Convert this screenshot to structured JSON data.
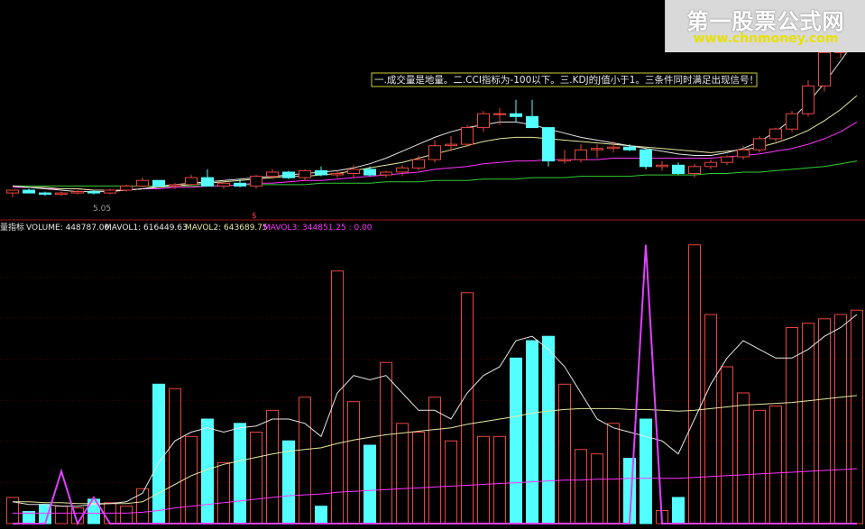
{
  "watermark": {
    "title": "第一股票公式网",
    "url": "www.chnmoney.com"
  },
  "note": "一.成交量是地量。二.CCI指标为-100以下。三.KDJ的J值小于1。三条件同时满足出现信号！",
  "price_label": "5.05",
  "signal_marker": "$",
  "indicator_header": {
    "name": "量指标",
    "volume": "VOLUME: 448787.00",
    "mavol1": "MAVOL1: 616449.63",
    "mavol2": "MAVOL2: 643689.75",
    "mavol3": "MAVOL3: 344851.25 : 0.00"
  },
  "colors": {
    "up": "#e8463e",
    "down": "#54ffff",
    "ma_white": "#e6e6e6",
    "ma_yellow": "#e6e6a0",
    "ma_magenta": "#ff33ff",
    "ma_green": "#33cc33",
    "signal": "#e040ff",
    "separator": "#a01818",
    "grid": "#5a0000",
    "note_border": "#cccc33"
  },
  "chart_data": {
    "type": "bar",
    "subtype": "candlestick_with_volume",
    "candles": [
      {
        "o": 9,
        "h": 11,
        "l": 6,
        "c": 11
      },
      {
        "o": 11,
        "h": 12,
        "l": 9,
        "c": 9
      },
      {
        "o": 9,
        "h": 10,
        "l": 7,
        "c": 8
      },
      {
        "o": 8,
        "h": 10,
        "l": 7,
        "c": 9
      },
      {
        "o": 9,
        "h": 11,
        "l": 8,
        "c": 10
      },
      {
        "o": 10,
        "h": 11,
        "l": 8,
        "c": 9
      },
      {
        "o": 9,
        "h": 12,
        "l": 8,
        "c": 11
      },
      {
        "o": 11,
        "h": 15,
        "l": 10,
        "c": 14
      },
      {
        "o": 14,
        "h": 20,
        "l": 13,
        "c": 18
      },
      {
        "o": 18,
        "h": 18,
        "l": 13,
        "c": 14
      },
      {
        "o": 14,
        "h": 16,
        "l": 12,
        "c": 15
      },
      {
        "o": 15,
        "h": 22,
        "l": 14,
        "c": 20
      },
      {
        "o": 20,
        "h": 26,
        "l": 14,
        "c": 14
      },
      {
        "o": 14,
        "h": 17,
        "l": 12,
        "c": 16
      },
      {
        "o": 16,
        "h": 19,
        "l": 13,
        "c": 14
      },
      {
        "o": 14,
        "h": 22,
        "l": 12,
        "c": 21
      },
      {
        "o": 21,
        "h": 26,
        "l": 19,
        "c": 24
      },
      {
        "o": 24,
        "h": 25,
        "l": 19,
        "c": 20
      },
      {
        "o": 20,
        "h": 26,
        "l": 18,
        "c": 25
      },
      {
        "o": 25,
        "h": 28,
        "l": 21,
        "c": 22
      },
      {
        "o": 22,
        "h": 25,
        "l": 20,
        "c": 23
      },
      {
        "o": 23,
        "h": 29,
        "l": 20,
        "c": 26
      },
      {
        "o": 26,
        "h": 28,
        "l": 21,
        "c": 22
      },
      {
        "o": 22,
        "h": 25,
        "l": 20,
        "c": 24
      },
      {
        "o": 24,
        "h": 29,
        "l": 21,
        "c": 27
      },
      {
        "o": 27,
        "h": 36,
        "l": 25,
        "c": 33
      },
      {
        "o": 33,
        "h": 47,
        "l": 31,
        "c": 43
      },
      {
        "o": 43,
        "h": 50,
        "l": 39,
        "c": 44
      },
      {
        "o": 44,
        "h": 58,
        "l": 42,
        "c": 56
      },
      {
        "o": 56,
        "h": 68,
        "l": 53,
        "c": 66
      },
      {
        "o": 66,
        "h": 70,
        "l": 58,
        "c": 66
      },
      {
        "o": 66,
        "h": 76,
        "l": 60,
        "c": 64
      },
      {
        "o": 64,
        "h": 76,
        "l": 60,
        "c": 56
      },
      {
        "o": 56,
        "h": 56,
        "l": 28,
        "c": 32
      },
      {
        "o": 32,
        "h": 40,
        "l": 30,
        "c": 33
      },
      {
        "o": 33,
        "h": 44,
        "l": 31,
        "c": 40
      },
      {
        "o": 40,
        "h": 44,
        "l": 34,
        "c": 41
      },
      {
        "o": 41,
        "h": 46,
        "l": 38,
        "c": 42
      },
      {
        "o": 42,
        "h": 44,
        "l": 39,
        "c": 40
      },
      {
        "o": 40,
        "h": 41,
        "l": 26,
        "c": 28
      },
      {
        "o": 28,
        "h": 32,
        "l": 25,
        "c": 29
      },
      {
        "o": 29,
        "h": 31,
        "l": 22,
        "c": 23
      },
      {
        "o": 23,
        "h": 30,
        "l": 20,
        "c": 28
      },
      {
        "o": 28,
        "h": 33,
        "l": 26,
        "c": 31
      },
      {
        "o": 31,
        "h": 36,
        "l": 29,
        "c": 35
      },
      {
        "o": 35,
        "h": 43,
        "l": 33,
        "c": 40
      },
      {
        "o": 40,
        "h": 50,
        "l": 38,
        "c": 48
      },
      {
        "o": 48,
        "h": 56,
        "l": 46,
        "c": 55
      },
      {
        "o": 55,
        "h": 68,
        "l": 53,
        "c": 66
      },
      {
        "o": 66,
        "h": 90,
        "l": 64,
        "c": 86
      },
      {
        "o": 86,
        "h": 112,
        "l": 82,
        "c": 110
      },
      {
        "o": 110,
        "h": 130,
        "l": 106,
        "c": 128
      },
      {
        "o": 128,
        "h": 140,
        "l": 124,
        "c": 138
      }
    ],
    "volume": [
      30,
      14,
      22,
      20,
      18,
      28,
      24,
      20,
      40,
      160,
      155,
      100,
      120,
      70,
      115,
      105,
      130,
      95,
      145,
      20,
      290,
      140,
      90,
      185,
      115,
      105,
      145,
      95,
      265,
      100,
      100,
      190,
      210,
      215,
      160,
      85,
      80,
      115,
      75,
      120,
      15,
      30,
      320,
      240,
      180,
      150,
      130,
      135,
      225,
      230,
      235,
      240,
      245
    ],
    "ma_price_white": [
      14,
      13,
      12,
      11,
      10,
      10,
      10,
      11,
      12,
      14,
      15,
      16,
      17,
      18,
      19,
      20,
      21,
      22,
      23,
      24,
      25,
      27,
      30,
      34,
      39,
      44,
      49,
      53,
      56,
      58,
      60,
      60,
      58,
      55,
      52,
      49,
      47,
      45,
      43,
      41,
      39,
      37,
      36,
      36,
      38,
      41,
      46,
      53,
      62,
      74,
      88,
      104,
      120
    ],
    "ma_price_yellow": [
      14,
      13,
      13,
      12,
      12,
      11,
      11,
      11,
      12,
      13,
      14,
      15,
      16,
      17,
      18,
      19,
      20,
      21,
      21,
      22,
      23,
      25,
      27,
      29,
      31,
      34,
      37,
      40,
      43,
      46,
      48,
      49,
      49,
      48,
      47,
      46,
      45,
      44,
      43,
      42,
      41,
      40,
      39,
      38,
      39,
      40,
      42,
      45,
      49,
      54,
      61,
      69,
      79
    ],
    "ma_price_magenta": [
      13,
      13,
      12,
      12,
      12,
      11,
      11,
      11,
      12,
      12,
      13,
      13,
      14,
      14,
      15,
      16,
      16,
      17,
      18,
      18,
      19,
      20,
      21,
      22,
      23,
      24,
      26,
      27,
      28,
      30,
      31,
      32,
      32,
      33,
      33,
      33,
      33,
      34,
      34,
      34,
      34,
      34,
      34,
      34,
      35,
      36,
      37,
      39,
      41,
      44,
      48,
      53,
      60
    ],
    "ma_price_green": [
      14,
      14,
      14,
      14,
      14,
      14,
      14,
      14,
      14,
      14,
      14,
      14,
      14,
      14,
      15,
      15,
      15,
      15,
      15,
      16,
      16,
      16,
      16,
      17,
      17,
      17,
      18,
      18,
      18,
      19,
      19,
      19,
      20,
      20,
      20,
      21,
      21,
      21,
      21,
      22,
      22,
      22,
      22,
      23,
      23,
      24,
      24,
      25,
      26,
      27,
      28,
      30,
      32
    ],
    "mavol1": [
      25,
      22,
      22,
      20,
      20,
      22,
      23,
      25,
      35,
      70,
      95,
      105,
      110,
      105,
      110,
      112,
      120,
      120,
      115,
      100,
      150,
      170,
      165,
      170,
      150,
      130,
      130,
      120,
      150,
      170,
      180,
      210,
      215,
      200,
      180,
      150,
      120,
      110,
      105,
      100,
      95,
      80,
      120,
      160,
      190,
      210,
      200,
      190,
      190,
      200,
      215,
      225,
      240
    ],
    "mavol2": [
      25,
      25,
      24,
      24,
      23,
      23,
      23,
      23,
      25,
      35,
      45,
      55,
      62,
      68,
      72,
      76,
      80,
      83,
      85,
      87,
      92,
      96,
      99,
      102,
      104,
      106,
      108,
      110,
      114,
      117,
      120,
      123,
      127,
      129,
      131,
      132,
      132,
      132,
      131,
      131,
      130,
      129,
      130,
      132,
      134,
      136,
      137,
      138,
      139,
      141,
      143,
      145,
      147
    ],
    "mavol3": [
      12,
      12,
      12,
      12,
      12,
      12,
      12,
      12,
      13,
      15,
      18,
      20,
      22,
      24,
      26,
      28,
      30,
      32,
      33,
      34,
      36,
      37,
      38,
      39,
      40,
      41,
      42,
      43,
      44,
      45,
      46,
      47,
      48,
      49,
      50,
      50,
      51,
      51,
      52,
      52,
      52,
      52,
      53,
      54,
      55,
      56,
      57,
      58,
      59,
      60,
      61,
      62,
      63
    ],
    "signal": [
      0,
      0,
      0,
      0,
      0,
      0,
      0,
      0,
      0,
      0,
      0,
      0,
      0,
      0,
      0,
      0,
      0,
      0,
      0,
      0,
      0,
      0,
      0,
      0,
      0,
      0,
      0,
      0,
      0,
      0,
      0,
      0,
      0,
      0,
      0,
      0,
      0,
      0,
      0,
      0,
      0,
      0,
      0,
      0,
      0,
      0,
      0,
      0,
      0,
      0,
      0,
      0,
      0
    ],
    "price_ylim": [
      0,
      140
    ],
    "volume_ylim": [
      0,
      330
    ],
    "grid": true
  }
}
